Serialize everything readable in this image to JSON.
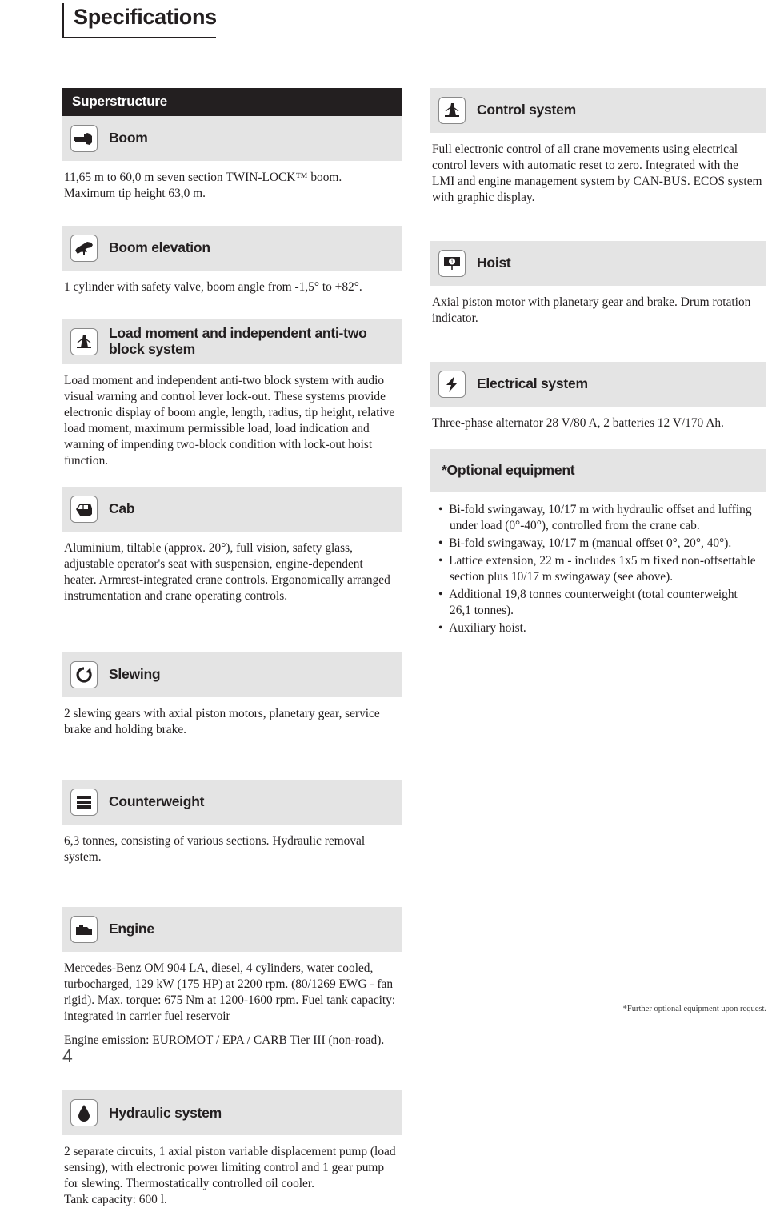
{
  "page": {
    "title": "Specifications",
    "folio": "4",
    "footnote": "*Further optional equipment upon request."
  },
  "left_column": {
    "section_bar": "Superstructure",
    "blocks": [
      {
        "icon": "boom-icon",
        "heading": "Boom",
        "text": "11,65 m to 60,0 m seven section TWIN-LOCK™ boom.\nMaximum tip height 63,0 m."
      },
      {
        "icon": "boom-elevation-icon",
        "heading": "Boom elevation",
        "text": "1 cylinder with safety valve, boom angle from -1,5° to +82°."
      },
      {
        "icon": "load-moment-icon",
        "heading": "Load moment and independent anti-two block system",
        "text": "Load moment and independent anti-two block system with audio visual warning and control lever lock-out. These systems provide electronic display of boom angle, length, radius, tip height, relative load moment, maximum permissible load, load indication and warning of impending two-block condition with lock-out hoist function."
      },
      {
        "icon": "cab-icon",
        "heading": "Cab",
        "text": "Aluminium, tiltable (approx. 20°), full vision, safety glass, adjustable operator's seat with suspension, engine-dependent heater. Armrest-integrated crane controls. Ergonomically arranged instrumentation and crane operating controls."
      },
      {
        "icon": "slewing-icon",
        "heading": "Slewing",
        "text": "2 slewing gears with axial piston motors, planetary gear, service brake and holding brake."
      },
      {
        "icon": "counterweight-icon",
        "heading": "Counterweight",
        "text": "6,3 tonnes, consisting of various sections. Hydraulic removal system."
      },
      {
        "icon": "engine-icon",
        "heading": "Engine",
        "text": "Mercedes-Benz OM 904 LA, diesel, 4 cylinders, water cooled, turbocharged, 129 kW (175 HP) at 2200 rpm. (80/1269 EWG - fan rigid). Max. torque: 675 Nm at 1200-1600 rpm. Fuel tank capacity: integrated in carrier fuel reservoir",
        "text2": "Engine emission: EUROMOT / EPA / CARB Tier III (non-road)."
      },
      {
        "icon": "hydraulic-system-icon",
        "heading": "Hydraulic system",
        "text": "2 separate circuits, 1 axial piston variable displacement pump (load sensing), with electronic power limiting control and 1 gear pump for slewing. Thermostatically controlled oil cooler.\nTank capacity: 600 l."
      }
    ]
  },
  "right_column": {
    "blocks": [
      {
        "icon": "control-system-icon",
        "heading": "Control system",
        "text": "Full electronic control of all crane movements using electrical control levers with automatic reset to zero. Integrated with the LMI and engine management system by CAN-BUS. ECOS system with graphic display."
      },
      {
        "icon": "hoist-icon",
        "heading": "Hoist",
        "text": "Axial piston motor with planetary gear and brake. Drum rotation indicator."
      },
      {
        "icon": "electrical-system-icon",
        "heading": "Electrical system",
        "text": "Three-phase alternator 28 V/80 A, 2 batteries 12 V/170 Ah."
      }
    ],
    "optional": {
      "heading": "*Optional equipment",
      "items": [
        "Bi-fold swingaway, 10/17 m with hydraulic offset and luffing under load (0°-40°), controlled from the crane cab.",
        "Bi-fold swingaway, 10/17 m (manual offset 0°, 20°, 40°).",
        "Lattice extension, 22 m - includes 1x5 m fixed non-offsettable section plus 10/17 m swingaway (see above).",
        "Additional 19,8 tonnes counterweight (total counterweight 26,1 tonnes).",
        "Auxiliary hoist."
      ]
    }
  },
  "colors": {
    "bar_black": "#231f20",
    "bar_grey": "#e4e4e4",
    "text": "#231f20"
  }
}
